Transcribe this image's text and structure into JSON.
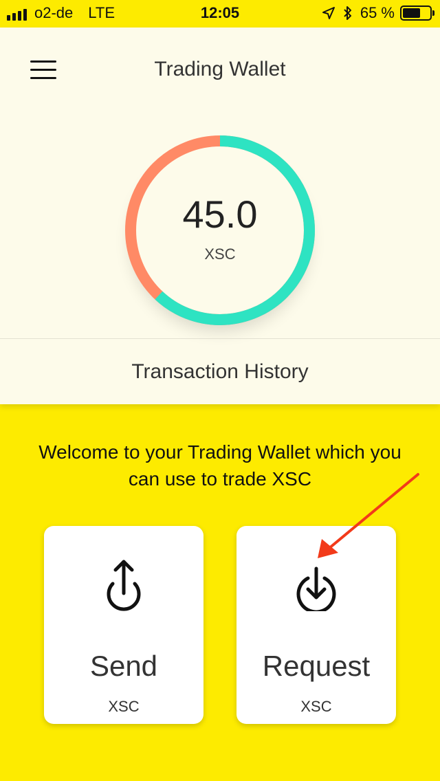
{
  "status_bar": {
    "carrier": "o2-de",
    "network": "LTE",
    "time": "12:05",
    "battery_percent": "65 %",
    "battery_level": 0.65,
    "icons": [
      "signal-icon",
      "location-arrow-icon",
      "bluetooth-icon",
      "battery-icon"
    ]
  },
  "header": {
    "title": "Trading Wallet",
    "menu_icon": "hamburger-menu-icon"
  },
  "balance": {
    "value": "45.0",
    "unit": "XSC",
    "ring_split_fraction": 0.62,
    "ring_colors": {
      "primary": "#2EE3C2",
      "secondary": "#FF8A66"
    }
  },
  "history": {
    "label": "Transaction History"
  },
  "welcome_text": "Welcome to your Trading Wallet which you can use to trade XSC",
  "actions": [
    {
      "label": "Send",
      "unit": "XSC",
      "icon": "upload-arrow-icon"
    },
    {
      "label": "Request",
      "unit": "XSC",
      "icon": "download-arrow-icon"
    }
  ],
  "colors": {
    "background": "#FDEB00",
    "card_background": "#FDFBEA",
    "annotation_arrow": "#F23A1A"
  }
}
